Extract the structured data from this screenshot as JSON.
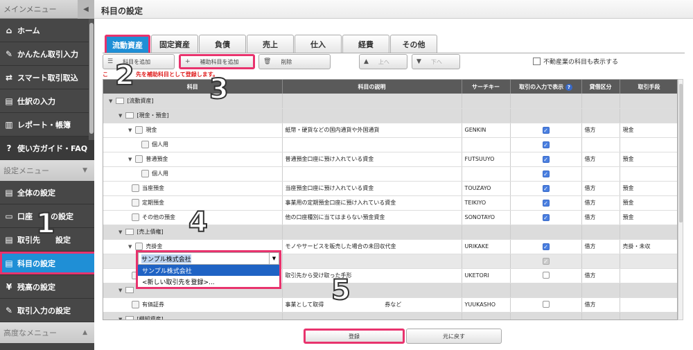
{
  "sidebar": {
    "main_menu": "メインメニュー",
    "items": [
      {
        "label": "ホーム",
        "icon": "home-icon",
        "glyph": "⌂"
      },
      {
        "label": "かんたん取引入力",
        "icon": "pencil-icon",
        "glyph": "✎"
      },
      {
        "label": "スマート取引取込",
        "icon": "import-icon",
        "glyph": "⇄"
      },
      {
        "label": "仕訳の入力",
        "icon": "journal-icon",
        "glyph": "▤"
      },
      {
        "label": "レポート・帳簿",
        "icon": "report-icon",
        "glyph": "▥"
      },
      {
        "label": "使い方ガイド・FAQ",
        "icon": "help-icon",
        "glyph": "?"
      }
    ],
    "settings_menu": "設定メニュー",
    "settings_items": [
      {
        "label": "全体の設定",
        "icon": "settings-doc-icon",
        "glyph": "▤"
      },
      {
        "label": "口座",
        "label2": "の設定",
        "icon": "bank-icon",
        "glyph": "▭"
      },
      {
        "label": "取引先",
        "label2": "設定",
        "icon": "client-icon",
        "glyph": "▤"
      },
      {
        "label": "科目の設定",
        "icon": "account-icon",
        "glyph": "▤",
        "active": true
      },
      {
        "label": "残高の設定",
        "icon": "balance-icon",
        "glyph": "¥"
      },
      {
        "label": "取引入力の設定",
        "icon": "input-settings-icon",
        "glyph": "✎"
      }
    ],
    "advanced_menu": "高度なメニュー"
  },
  "page": {
    "title": "科目の設定"
  },
  "tabs": [
    "流動資産",
    "固定資産",
    "負債",
    "売上",
    "仕入",
    "経費",
    "その他"
  ],
  "toolbar": {
    "add_account": "科目を追加",
    "add_sub_account": "補助科目を追加",
    "delete": "削除",
    "up": "上へ",
    "down": "下へ",
    "show_real_estate": "不動産業の科目も表示する"
  },
  "notice": "こ　　　　　先を補助科目として登録します。",
  "table": {
    "headers": [
      "科目",
      "科目の説明",
      "サーチキー",
      "取引の入力で表示",
      "貸借区分",
      "取引手段"
    ],
    "rows": [
      {
        "level": 0,
        "type": "folder",
        "name": "[流動資産]",
        "desc": "",
        "key": "",
        "show": "",
        "side": "",
        "method": "",
        "gray": true
      },
      {
        "level": 1,
        "type": "folder",
        "name": "[現金・預金]",
        "desc": "",
        "key": "",
        "show": "",
        "side": "",
        "method": "",
        "gray": true
      },
      {
        "level": 2,
        "type": "account",
        "name": "現金",
        "desc": "紙幣・硬貨などの国内通貨や外国通貨",
        "key": "GENKIN",
        "show": "on",
        "side": "借方",
        "method": "現金"
      },
      {
        "level": 3,
        "type": "account",
        "name": "個人用",
        "desc": "",
        "key": "",
        "show": "on",
        "side": "",
        "method": ""
      },
      {
        "level": 2,
        "type": "account",
        "name": "普通預金",
        "desc": "普通預金口座に預け入れている資金",
        "key": "FUTSUUYO",
        "show": "on",
        "side": "借方",
        "method": "預金"
      },
      {
        "level": 3,
        "type": "account",
        "name": "個人用",
        "desc": "",
        "key": "",
        "show": "on",
        "side": "",
        "method": ""
      },
      {
        "level": 2,
        "type": "account",
        "name": "当座預金",
        "desc": "当座預金口座に預け入れている資金",
        "key": "TOUZAYO",
        "show": "on",
        "side": "借方",
        "method": "預金"
      },
      {
        "level": 2,
        "type": "account",
        "name": "定期預金",
        "desc": "事業用の定期預金口座に預け入れている資金",
        "key": "TEIKIYO",
        "show": "on",
        "side": "借方",
        "method": "預金"
      },
      {
        "level": 2,
        "type": "account",
        "name": "その他の預金",
        "desc": "他の口座種別に当てはまらない預金資金",
        "key": "SONOTAYO",
        "show": "on",
        "side": "借方",
        "method": "預金"
      },
      {
        "level": 1,
        "type": "folder",
        "name": "[売上債権]",
        "desc": "",
        "key": "",
        "show": "",
        "side": "",
        "method": "",
        "gray": true
      },
      {
        "level": 2,
        "type": "account",
        "name": "売掛金",
        "desc": "モノやサービスを販売した場合の未回収代金",
        "key": "URIKAKE",
        "show": "on",
        "side": "借方",
        "method": "売掛・未収"
      },
      {
        "level": 3,
        "type": "edit",
        "name": "",
        "desc": "",
        "key": "",
        "show": "gray",
        "side": "",
        "method": "",
        "sel": true
      },
      {
        "level": 2,
        "type": "account",
        "name": "",
        "desc": "取引先から受け取った手形",
        "key": "UKETORI",
        "show": "off",
        "side": "借方",
        "method": ""
      },
      {
        "level": 1,
        "type": "folder",
        "name": "",
        "desc": "",
        "key": "",
        "show": "",
        "side": "",
        "method": "",
        "gray": true
      },
      {
        "level": 2,
        "type": "account",
        "name": "有価証券",
        "desc": "事業として取得",
        "desc2": "券など",
        "key": "YUUKASHO",
        "show": "off",
        "side": "借方",
        "method": ""
      },
      {
        "level": 1,
        "type": "folder",
        "name": "[棚卸資産]",
        "desc": "",
        "key": "",
        "show": "",
        "side": "",
        "method": "",
        "gray": true
      }
    ]
  },
  "dropdown": {
    "value": "サンプル株式会社",
    "options": [
      "サンプル株式会社",
      "<新しい取引先を登録>..."
    ]
  },
  "footer": {
    "register": "登録",
    "back": "元に戻す"
  },
  "step_numbers": [
    "1",
    "2",
    "3",
    "4",
    "5"
  ],
  "colors": {
    "accent": "#1f8fd6",
    "highlight": "#e8336d",
    "header": "#5a5a5a"
  }
}
